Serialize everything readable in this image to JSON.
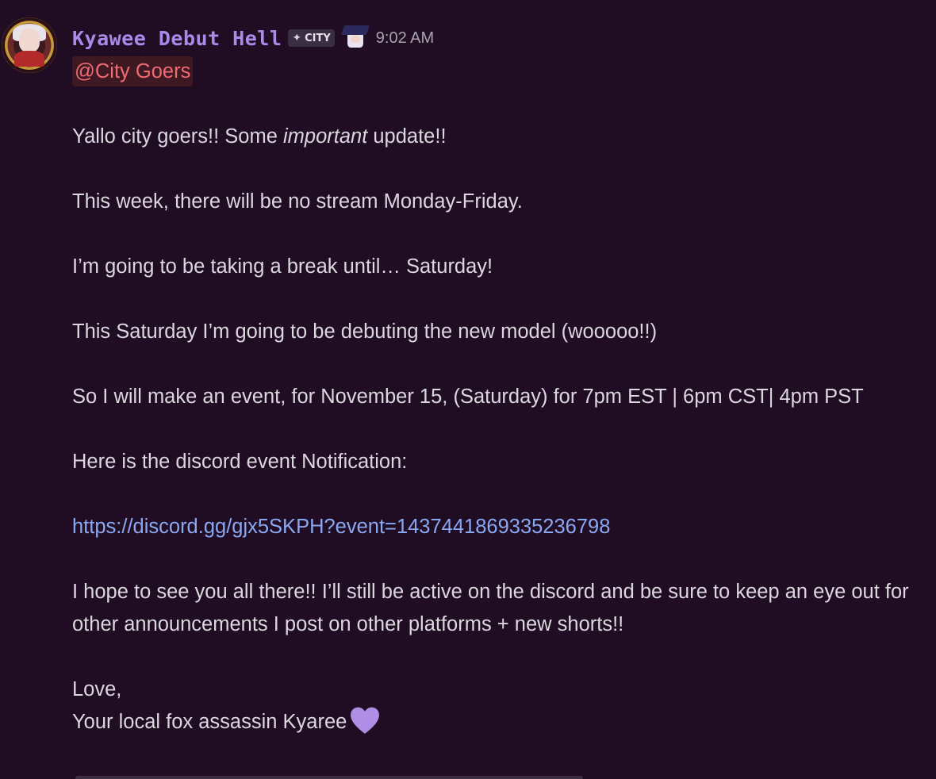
{
  "message": {
    "author": {
      "name": "Kyawee Debut Hell",
      "tag_label": "CITY",
      "tag_icon": "sparkle-icon",
      "name_color": "#a88ae8"
    },
    "timestamp": "9:02 AM",
    "mention": "@City Goers",
    "line1_before": "Yallo city goers!! Some ",
    "line1_italic": "important",
    "line1_after": " update!!",
    "line2": "This week, there will be no stream Monday-Friday.",
    "line3": "I’m going to be taking a break until… Saturday!",
    "line4": "This Saturday I’m going to be debuting the new model (wooooo!!)",
    "line5": "So I will make an event, for November 15, (Saturday) for 7pm EST | 6pm CST| 4pm PST",
    "line6": "Here is the discord event Notification:",
    "link": "https://discord.gg/gjx5SKPH?event=1437441869335236798",
    "line7": "I hope to see you all there!! I’ll still be active on the discord and be sure to keep an eye out for other announcements I post on other platforms + new shorts!!",
    "sign_off_1": "Love,",
    "sign_off_2": "Your local fox assassin Kyaree",
    "emoji": "purple-heart-icon"
  },
  "colors": {
    "background": "#200d24",
    "text": "#dcd6de",
    "mention_text": "#f06a72",
    "mention_bg": "#3e1823",
    "link": "#8aa8f2",
    "heart": "#b18ee6"
  }
}
